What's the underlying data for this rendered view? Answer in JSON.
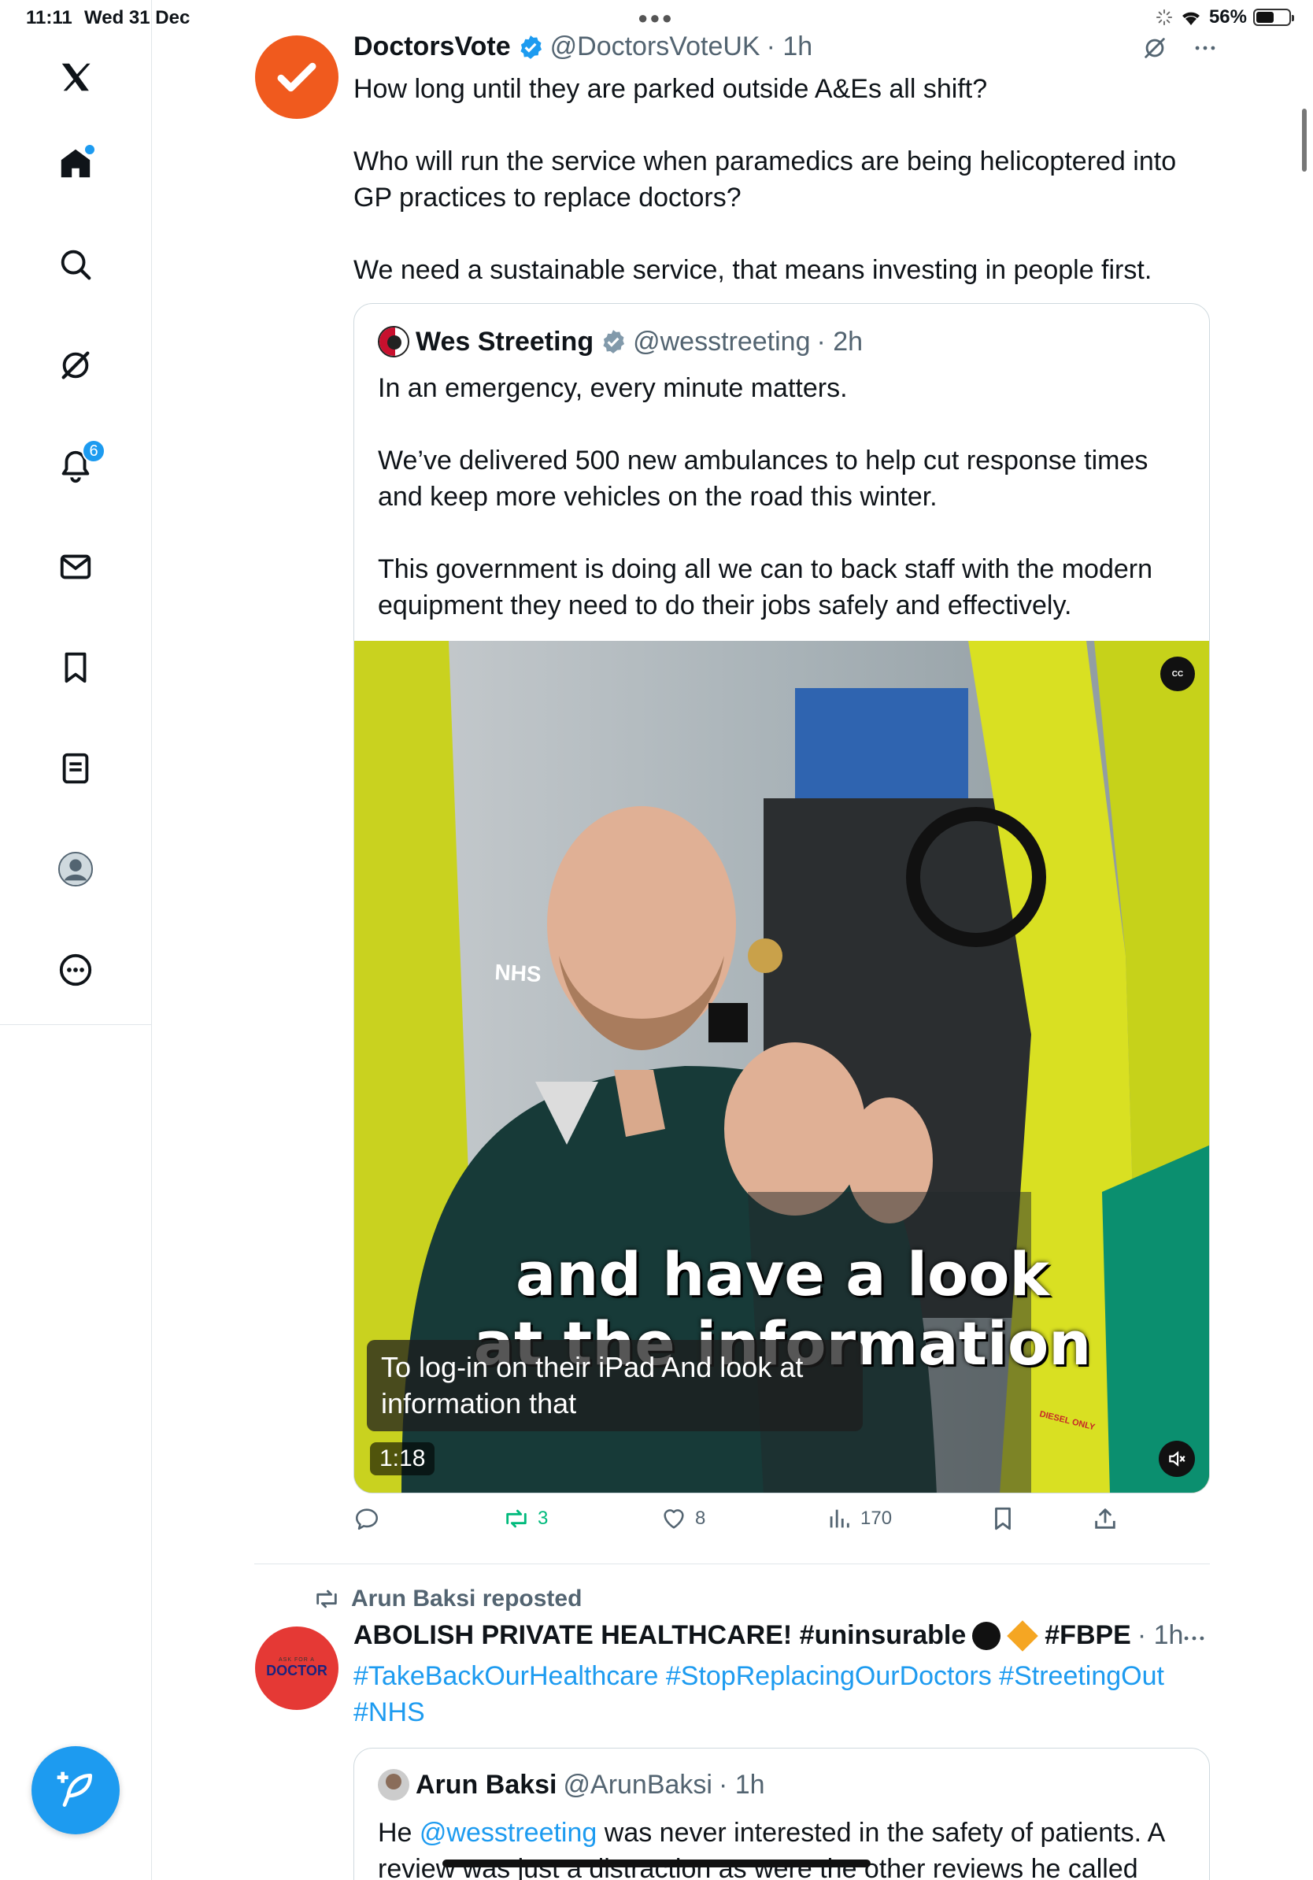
{
  "status_bar": {
    "time": "11:11",
    "date": "Wed 31 Dec",
    "battery": "56%",
    "battery_level": 0.56
  },
  "nav": {
    "notifications_badge": "6"
  },
  "tweet1": {
    "name": "DoctorsVote",
    "handle": "@DoctorsVoteUK",
    "time": "· 1h",
    "text": "How long until they are parked outside A&Es all shift?\n\nWho will run the service when paramedics are being helicoptered into GP practices to replace doctors?\n\nWe need a sustainable service, that means investing in people first.",
    "quote": {
      "name": "Wes Streeting",
      "handle": "@wesstreeting",
      "time": "· 2h",
      "text": "In an emergency, every minute matters.\n\nWe’ve delivered 500 new ambulances to help cut response times and keep more vehicles on the road this winter.\n\nThis government is doing all we can to back staff with the modern equipment they need to do their jobs safely and effectively.",
      "video": {
        "cc_label": "CC",
        "burned_caption_line1": "and have a look",
        "burned_caption_line2": "at the information",
        "subtitle": "To log-in on their iPad And look at information that",
        "nhs_logo": "NHS",
        "diesel_label": "DIESEL ONLY",
        "duration": "1:18"
      }
    },
    "actions": {
      "reposts": "3",
      "likes": "8",
      "views": "170"
    }
  },
  "tweet2": {
    "repost_label": "Arun Baksi reposted",
    "avatar_small": "ASK FOR A",
    "avatar_big": "DOCTOR",
    "name_part1": "ABOLISH PRIVATE HEALTHCARE! #uninsurable",
    "name_part2": "#FBPE",
    "time": "· 1h",
    "hashtags": "#TakeBackOurHealthcare #StopReplacingOurDoctors #StreetingOut #NHS",
    "quote": {
      "name": "Arun Baksi",
      "handle": "@ArunBaksi",
      "time": "· 1h",
      "text_before": "He ",
      "mention": "@wesstreeting",
      "text_after": " was never interested in the safety of patients. A review was just a distraction as were the other reviews he called"
    }
  },
  "colors": {
    "accent": "#1d9bf0",
    "repost_green": "#00ba7c",
    "doctorsvote_orange": "#f05a1e"
  }
}
